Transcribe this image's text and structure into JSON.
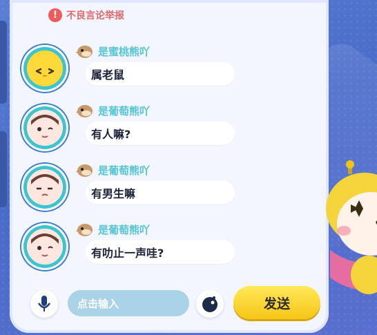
{
  "report": {
    "label": "不良言论举报",
    "icon": "warning-icon"
  },
  "messages": [
    {
      "name": "是蜜桃熊吖",
      "text": "属老鼠"
    },
    {
      "name": "是葡萄熊吖",
      "text": "有人嘛?"
    },
    {
      "name": "是葡萄熊吖",
      "text": "有男生嘛"
    },
    {
      "name": "是葡萄熊吖",
      "text": "有叻止一声哇?"
    }
  ],
  "input": {
    "placeholder": "点击输入"
  },
  "send": {
    "label": "发送"
  },
  "colors": {
    "accent": "#54c6d6",
    "send": "#f6c617",
    "warning": "#ef5b5b"
  }
}
